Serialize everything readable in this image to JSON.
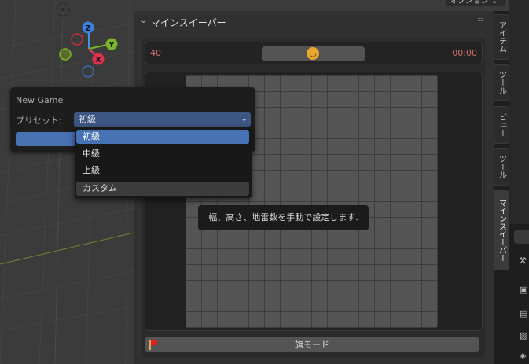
{
  "top_bar": {
    "options_label": "オプション ⌄"
  },
  "viewport": {
    "gizmo": {
      "z": "Z",
      "y": "Y",
      "x": "X"
    }
  },
  "panel": {
    "title": "マインスイーパー",
    "mine_count": "40",
    "timer": "00:00",
    "face": "smiley-icon",
    "flag_mode_label": "旗モード",
    "grid": {
      "columns": 16,
      "rows": 16
    }
  },
  "tabs": [
    {
      "label": "アイテム",
      "active": false
    },
    {
      "label": "ツール",
      "active": false
    },
    {
      "label": "ビュー",
      "active": false
    },
    {
      "label": "ツール",
      "active": false
    },
    {
      "label": "マインスイーパー",
      "active": true
    }
  ],
  "popup": {
    "title": "New Game",
    "preset_label": "プリセット:",
    "preset_value": "初級",
    "options": [
      "初級",
      "中級",
      "上級",
      "カスタム"
    ],
    "selected_index": 0,
    "hovered_index": 3
  },
  "tooltip": {
    "text": "幅、高さ、地雷数を手動で設定します."
  },
  "colors": {
    "accent": "#4772b3",
    "counter": "#d07070",
    "face": "#e9a72e",
    "flag": "#e02020"
  }
}
